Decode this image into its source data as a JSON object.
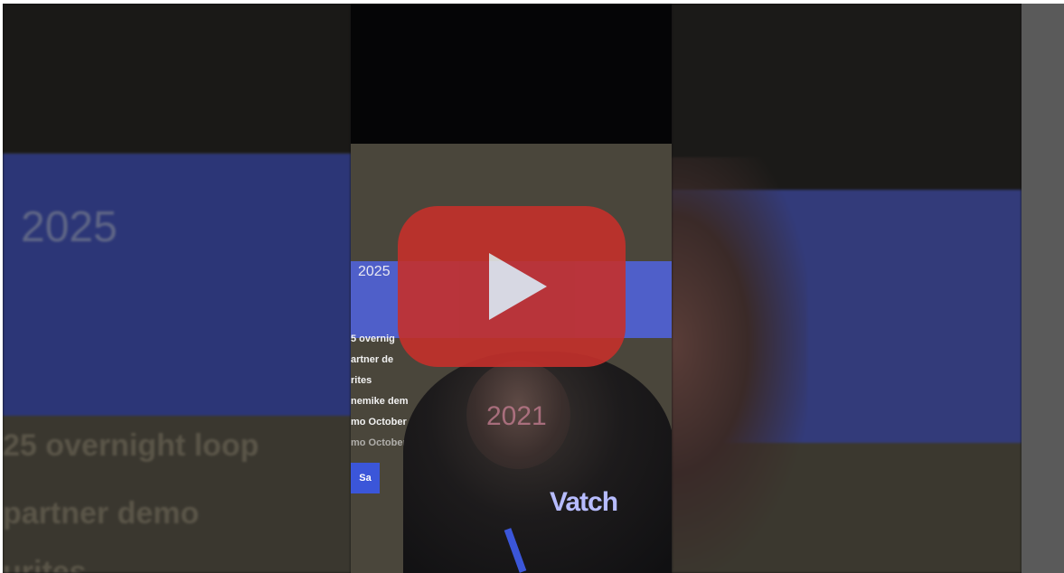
{
  "player": {
    "state": "paused",
    "play_button": {
      "icon": "play-icon",
      "color": "#c4302b"
    }
  },
  "video_frame": {
    "screen_year": "2025",
    "list_items": [
      "5 overnig",
      "artner de",
      "rites",
      "nemike dem",
      "mo October",
      "mo October"
    ],
    "button_text": "Sa",
    "reflection_text": "2021",
    "brand_text": "Vatch"
  },
  "backdrop_left": {
    "year": "2025",
    "lines": [
      "25 overnight loop",
      "partner demo",
      "urites"
    ]
  },
  "colors": {
    "accent": "#4f5fc9",
    "youtube_red": "#c4302b",
    "scrollbar": "#5a5a5a"
  }
}
